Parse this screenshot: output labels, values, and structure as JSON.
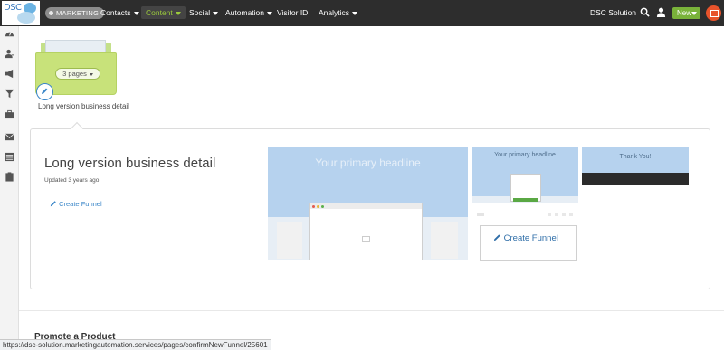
{
  "topnav": {
    "logo_text": "DSC",
    "badge": "MARKETING",
    "items": [
      {
        "label": "Contacts"
      },
      {
        "label": "Content"
      },
      {
        "label": "Social"
      },
      {
        "label": "Automation"
      },
      {
        "label": "Visitor ID"
      },
      {
        "label": "Analytics"
      }
    ],
    "account": "DSC Solution",
    "new_label": "New",
    "icons": [
      "search-icon",
      "user-icon",
      "calendar-icon"
    ],
    "accent": "#9ccc3c"
  },
  "sidebar": {
    "icons": [
      "dashboard-icon",
      "contacts-icon",
      "megaphone-icon",
      "filter-icon",
      "briefcase-icon",
      "envelope-icon",
      "list-icon",
      "clipboard-icon"
    ]
  },
  "funnel": {
    "pages_label": "3 pages",
    "name": "Long version business detail"
  },
  "detail": {
    "title": "Long version business detail",
    "updated": "Updated 3 years ago",
    "create_funnel": "Create Funnel"
  },
  "previews": {
    "main_headline": "Your primary headline",
    "optin_headline": "Your primary headline",
    "thanks_headline": "Thank You!",
    "create_funnel": "Create Funnel"
  },
  "section": {
    "promote": "Promote a Product"
  },
  "status_url": "https://dsc-solution.marketingautomation.services/pages/confirmNewFunnel/25601"
}
